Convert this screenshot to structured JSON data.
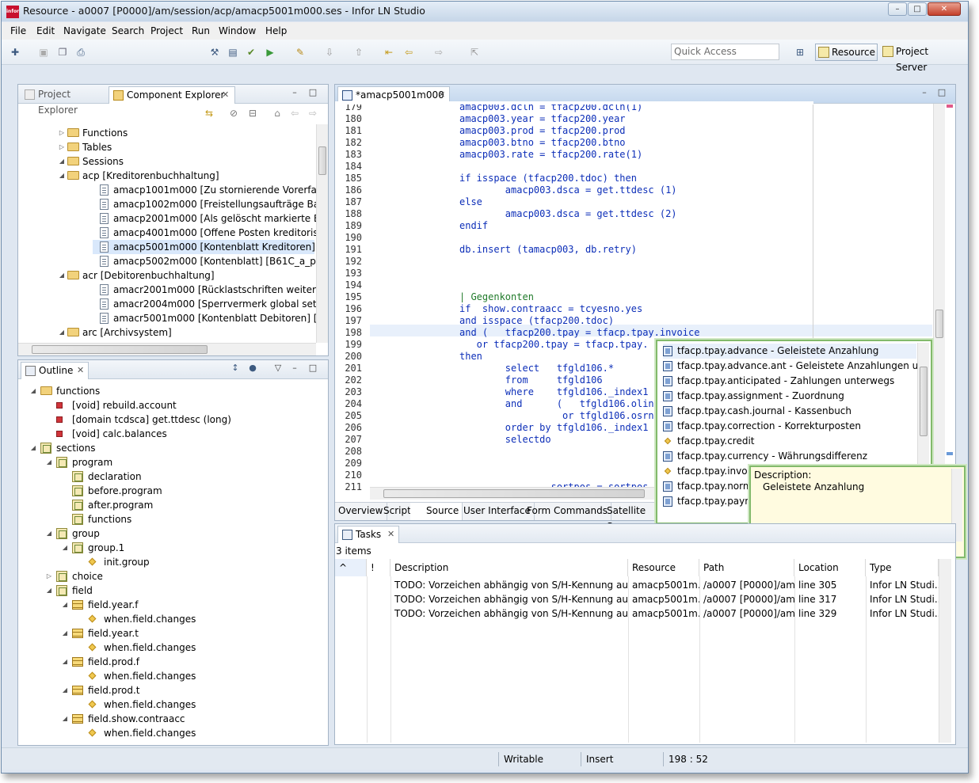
{
  "window": {
    "title": "Resource - a0007 [P0000]/am/session/acp/amacp5001m000.ses - Infor LN Studio",
    "logo_text": "infor",
    "minimize": "–",
    "maximize": "□",
    "close": "✕"
  },
  "menu": [
    "File",
    "Edit",
    "Navigate",
    "Search",
    "Project",
    "Run",
    "Window",
    "Help"
  ],
  "toolbar": {
    "quick_access_placeholder": "Quick Access",
    "perspectives": [
      "Resource",
      "Project Server"
    ]
  },
  "component_explorer": {
    "tabs": [
      "Project Explorer",
      "Component Explorer"
    ],
    "tree": [
      {
        "label": "Functions",
        "kind": "folder",
        "expanded": false
      },
      {
        "label": "Tables",
        "kind": "folder",
        "expanded": false
      },
      {
        "label": "Sessions",
        "kind": "folder",
        "expanded": true
      },
      {
        "label": "acp [Kreditorenbuchhaltung]",
        "kind": "folder",
        "expanded": true
      },
      {
        "label": "amacp1001m000 [Zu stornierende Vorerfassunge",
        "kind": "doc"
      },
      {
        "label": "amacp1002m000 [Freistellungsaufträge Bauabzu",
        "kind": "doc"
      },
      {
        "label": "amacp2001m000 [Als gelöscht markierte Belege",
        "kind": "doc"
      },
      {
        "label": "amacp4001m000 [Offene Posten kreditorisch na",
        "kind": "doc"
      },
      {
        "label": "amacp5001m000 [Kontenblatt Kreditoren] [B61C_",
        "kind": "doc",
        "selected": true
      },
      {
        "label": "amacp5002m000 [Kontenblatt] [B61C_a_prd]",
        "kind": "doc"
      },
      {
        "label": "acr [Debitorenbuchhaltung]",
        "kind": "folder",
        "expanded": true
      },
      {
        "label": "amacr2001m000 [Rücklastschriften weiterbelaste",
        "kind": "doc"
      },
      {
        "label": "amacr2004m000 [Sperrvermerk global setzen] [B",
        "kind": "doc"
      },
      {
        "label": "amacr5001m000 [Kontenblatt Debitoren] [B61C_a",
        "kind": "doc"
      },
      {
        "label": "arc [Archivsystem]",
        "kind": "folder",
        "expanded": true
      }
    ]
  },
  "outline": {
    "tab": "Outline",
    "tree": [
      {
        "label": "functions",
        "kind": "folder",
        "depth": 0
      },
      {
        "label": "[void] rebuild.account",
        "kind": "func",
        "depth": 1
      },
      {
        "label": "[domain tcdsca] get.ttdesc (long)",
        "kind": "func",
        "depth": 1
      },
      {
        "label": "[void] calc.balances",
        "kind": "func",
        "depth": 1
      },
      {
        "label": "sections",
        "kind": "sect",
        "depth": 0
      },
      {
        "label": "program",
        "kind": "sect",
        "depth": 1
      },
      {
        "label": "declaration",
        "kind": "sect",
        "depth": 2
      },
      {
        "label": "before.program",
        "kind": "sect",
        "depth": 2
      },
      {
        "label": "after.program",
        "kind": "sect",
        "depth": 2
      },
      {
        "label": "functions",
        "kind": "sect",
        "depth": 2
      },
      {
        "label": "group",
        "kind": "sect",
        "depth": 1
      },
      {
        "label": "group.1",
        "kind": "sect",
        "depth": 2
      },
      {
        "label": "init.group",
        "kind": "diam",
        "depth": 3
      },
      {
        "label": "choice",
        "kind": "sect",
        "depth": 1
      },
      {
        "label": "field",
        "kind": "sect",
        "depth": 1
      },
      {
        "label": "field.year.f",
        "kind": "tbl",
        "depth": 2
      },
      {
        "label": "when.field.changes",
        "kind": "diam",
        "depth": 3
      },
      {
        "label": "field.year.t",
        "kind": "tbl",
        "depth": 2
      },
      {
        "label": "when.field.changes",
        "kind": "diam",
        "depth": 3
      },
      {
        "label": "field.prod.f",
        "kind": "tbl",
        "depth": 2
      },
      {
        "label": "when.field.changes",
        "kind": "diam",
        "depth": 3
      },
      {
        "label": "field.prod.t",
        "kind": "tbl",
        "depth": 2
      },
      {
        "label": "when.field.changes",
        "kind": "diam",
        "depth": 3
      },
      {
        "label": "field.show.contraacc",
        "kind": "tbl",
        "depth": 2
      },
      {
        "label": "when.field.changes",
        "kind": "diam",
        "depth": 3
      }
    ]
  },
  "editor": {
    "tab": "*amacp5001m000",
    "lines": [
      {
        "n": "179",
        "t": "amacp003.dcln = tfacp200.dcln(1)"
      },
      {
        "n": "180",
        "t": "amacp003.year = tfacp200.year"
      },
      {
        "n": "181",
        "t": "amacp003.prod = tfacp200.prod"
      },
      {
        "n": "182",
        "t": "amacp003.btno = tfacp200.btno"
      },
      {
        "n": "183",
        "t": "amacp003.rate = tfacp200.rate(1)"
      },
      {
        "n": "184",
        "t": ""
      },
      {
        "n": "185",
        "t": "if isspace (tfacp200.tdoc) then"
      },
      {
        "n": "186",
        "t": "        amacp003.dsca = get.ttdesc (1)"
      },
      {
        "n": "187",
        "t": "else"
      },
      {
        "n": "188",
        "t": "        amacp003.dsca = get.ttdesc (2)"
      },
      {
        "n": "189",
        "t": "endif"
      },
      {
        "n": "190",
        "t": ""
      },
      {
        "n": "191",
        "t": "db.insert (tamacp003, db.retry)"
      },
      {
        "n": "192",
        "t": ""
      },
      {
        "n": "193",
        "t": ""
      },
      {
        "n": "194",
        "t": ""
      },
      {
        "n": "195",
        "t": "| Gegenkonten",
        "c": "green"
      },
      {
        "n": "196",
        "t": "if  show.contraacc = tcyesno.yes"
      },
      {
        "n": "197",
        "t": "and isspace (tfacp200.tdoc)"
      },
      {
        "n": "198",
        "t": "and (   tfacp200.tpay = tfacp.tpay.invoice"
      },
      {
        "n": "199",
        "t": "   or tfacp200.tpay = tfacp.tpay."
      },
      {
        "n": "200",
        "t": "then"
      },
      {
        "n": "201",
        "t": "        select   tfgld106.*"
      },
      {
        "n": "202",
        "t": "        from     tfgld106"
      },
      {
        "n": "203",
        "t": "        where    tfgld106._index1 ="
      },
      {
        "n": "204",
        "t": "        and      (   tfgld106.olin"
      },
      {
        "n": "205",
        "t": "                  or tfgld106.osrn"
      },
      {
        "n": "206",
        "t": "        order by tfgld106._index1"
      },
      {
        "n": "207",
        "t": "        selectdo"
      },
      {
        "n": "208",
        "t": ""
      },
      {
        "n": "209",
        "t": ""
      },
      {
        "n": "210",
        "t": ""
      },
      {
        "n": "211",
        "t": "                sortpos = sortpos +"
      }
    ],
    "bottom_tabs": [
      "Overview",
      "Script",
      "Source",
      "User Interface",
      "Form Commands",
      "Satellite Ses"
    ]
  },
  "content_assist": {
    "items": [
      {
        "label": "tfacp.tpay.advance  - Geleistete Anzahlung",
        "kind": "field"
      },
      {
        "label": "tfacp.tpay.advance.ant  - Geleistete Anzahlungen unterwe",
        "kind": "field"
      },
      {
        "label": "tfacp.tpay.anticipated  - Zahlungen unterwegs",
        "kind": "field"
      },
      {
        "label": "tfacp.tpay.assignment  - Zuordnung",
        "kind": "field"
      },
      {
        "label": "tfacp.tpay.cash.journal  - Kassenbuch",
        "kind": "field"
      },
      {
        "label": "tfacp.tpay.correction  - Korrekturposten",
        "kind": "field"
      },
      {
        "label": "tfacp.tpay.credit",
        "kind": "const"
      },
      {
        "label": "tfacp.tpay.currency  - Währungsdifferenz",
        "kind": "field"
      },
      {
        "label": "tfacp.tpay.invoice",
        "kind": "const"
      },
      {
        "label": "tfacp.tpay.normal",
        "kind": "field"
      },
      {
        "label": "tfacp.tpay.payme",
        "kind": "field"
      }
    ],
    "description_label": "Description:",
    "description_text": "Geleistete Anzahlung"
  },
  "tasks": {
    "tab": "Tasks",
    "count": "3 items",
    "columns": [
      "!",
      "Description",
      "Resource",
      "Path",
      "Location",
      "Type"
    ],
    "rows": [
      {
        "description": "TODO: Vorzeichen abhängig von S/H-Kennung auf tf...",
        "resource": "amacp5001m...",
        "path": "/a0007 [P0000]/am...",
        "location": "line 305",
        "type": "Infor LN Studi..."
      },
      {
        "description": "TODO: Vorzeichen abhängig von S/H-Kennung auf tf...",
        "resource": "amacp5001m...",
        "path": "/a0007 [P0000]/am...",
        "location": "line 317",
        "type": "Infor LN Studi..."
      },
      {
        "description": "TODO: Vorzeichen abhängig von S/H-Kennung auf tf...",
        "resource": "amacp5001m...",
        "path": "/a0007 [P0000]/am...",
        "location": "line 329",
        "type": "Infor LN Studi..."
      }
    ]
  },
  "status": {
    "mode": "Writable",
    "insert": "Insert",
    "position": "198 : 52"
  }
}
